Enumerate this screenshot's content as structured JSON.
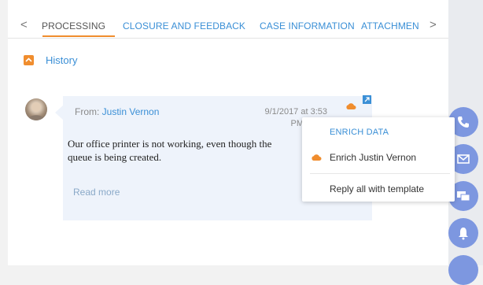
{
  "tabs": {
    "prev_arrow": "<",
    "next_arrow": ">",
    "items": [
      {
        "label": "PROCESSING",
        "active": true
      },
      {
        "label": "CLOSURE AND FEEDBACK",
        "active": false
      },
      {
        "label": "CASE INFORMATION",
        "active": false
      },
      {
        "label": "ATTACHMEN",
        "active": false
      }
    ]
  },
  "history": {
    "label": "History"
  },
  "message": {
    "from_prefix": "From: ",
    "from_name": "Justin Vernon",
    "date_line1": "9/1/2017 at 3:53",
    "date_line2": "PM via Ei",
    "body_line1": "Our office printer is not working, even though the",
    "body_line2": "queue is being created.",
    "read_more": "Read more"
  },
  "menu": {
    "header": "ENRICH DATA",
    "enrich_item": "Enrich Justin Vernon",
    "reply_item": "Reply all with template"
  },
  "colors": {
    "accent": "#f08d2e",
    "link": "#3a8fd6",
    "bubble": "#eef3fb",
    "action_circle": "#7d97e0"
  },
  "icons": {
    "history_toggle": "chevron-up-icon",
    "cloud": "cloud-icon",
    "expand": "open-external-icon",
    "actions": [
      "phone-icon",
      "email-icon",
      "chat-icon",
      "bell-icon"
    ]
  }
}
